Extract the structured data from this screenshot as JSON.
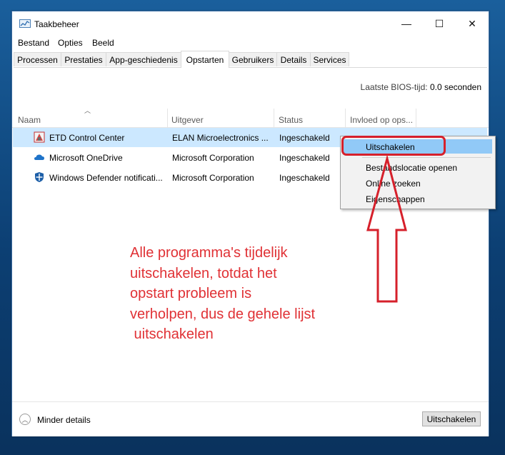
{
  "window": {
    "title": "Taakbeheer"
  },
  "controls": {
    "minimize": "—",
    "maximize": "☐",
    "close": "✕"
  },
  "menu": [
    "Bestand",
    "Opties",
    "Beeld"
  ],
  "tabs": [
    "Processen",
    "Prestaties",
    "App-geschiedenis",
    "Opstarten",
    "Gebruikers",
    "Details",
    "Services"
  ],
  "active_tab": "Opstarten",
  "bios": {
    "label": "Laatste BIOS-tijd:",
    "value": "0.0 seconden"
  },
  "columns": [
    "Naam",
    "Uitgever",
    "Status",
    "Invloed op ops..."
  ],
  "rows": [
    {
      "name": "ETD Control Center",
      "publisher": "ELAN Microelectronics ...",
      "status": "Ingeschakeld",
      "icon": "etd-icon"
    },
    {
      "name": "Microsoft OneDrive",
      "publisher": "Microsoft Corporation",
      "status": "Ingeschakeld",
      "icon": "onedrive-icon"
    },
    {
      "name": "Windows Defender notificati...",
      "publisher": "Microsoft Corporation",
      "status": "Ingeschakeld",
      "icon": "defender-icon"
    }
  ],
  "context_menu": [
    "Uitschakelen",
    "Bestandslocatie openen",
    "Online zoeken",
    "Eigenschappen"
  ],
  "annotation": {
    "lines": [
      "Alle programma's tijdelijk",
      "uitschakelen, totdat het",
      "opstart probleem is",
      "verholpen, dus de gehele lijst",
      " uitschakelen"
    ],
    "color": "#e03135"
  },
  "footer": {
    "less_details": "Minder details",
    "disable_button": "Uitschakelen"
  },
  "colors": {
    "selection": "#cce8ff",
    "menu_highlight": "#91c9f7",
    "annotation_red": "#d6202b"
  }
}
